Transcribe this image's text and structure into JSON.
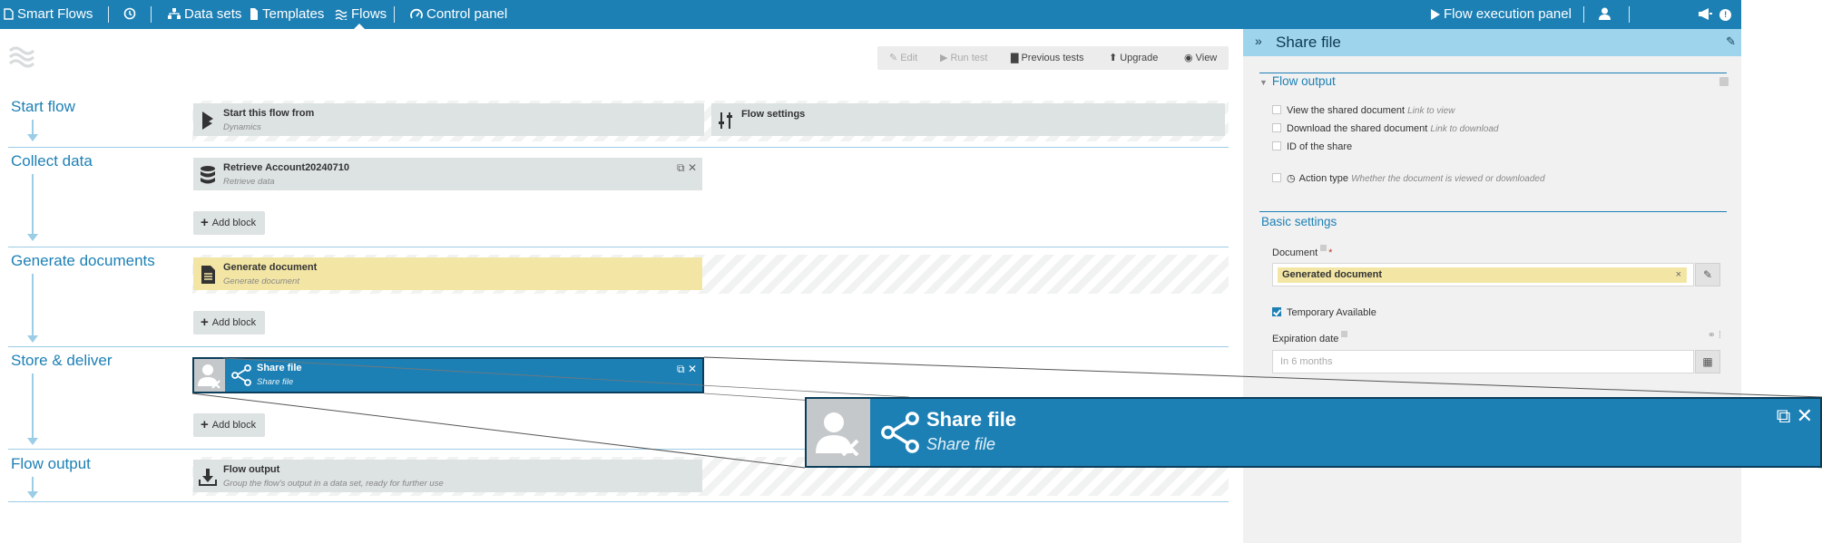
{
  "nav": {
    "app_name": "Smart Flows",
    "datasets": "Data sets",
    "templates": "Templates",
    "flows": "Flows",
    "control_panel": "Control panel",
    "execution_panel": "Flow execution panel",
    "notification_count": "!"
  },
  "toolbar": {
    "edit": "Edit",
    "run_test": "Run test",
    "previous_tests": "Previous tests",
    "upgrade": "Upgrade",
    "view": "View"
  },
  "stages": [
    {
      "title": "Start flow"
    },
    {
      "title": "Collect data"
    },
    {
      "title": "Generate documents"
    },
    {
      "title": "Store & deliver"
    },
    {
      "title": "Flow output"
    }
  ],
  "blocks": {
    "start_from": {
      "title": "Start this flow from",
      "sub": "Dynamics"
    },
    "flow_settings": {
      "title": "Flow settings"
    },
    "retrieve": {
      "title": "Retrieve Account20240710",
      "sub": "Retrieve data"
    },
    "generate": {
      "title": "Generate document",
      "sub": "Generate document"
    },
    "share": {
      "title": "Share file",
      "sub": "Share file"
    },
    "output": {
      "title": "Flow output",
      "sub": "Group the flow's output in a data set, ready for further use"
    }
  },
  "add_block_label": "Add block",
  "panel": {
    "title": "Share file",
    "flow_output_title": "Flow output",
    "outputs": [
      {
        "label": "View the shared document",
        "hint": "Link to view"
      },
      {
        "label": "Download the shared document",
        "hint": "Link to download"
      },
      {
        "label": "ID of the share",
        "hint": ""
      }
    ],
    "action_type": {
      "label": "Action type",
      "hint": "Whether the document is viewed or downloaded"
    },
    "basic_settings_title": "Basic settings",
    "document_label": "Document",
    "required_mark": "*",
    "document_value": "Generated document",
    "temporary_label": "Temporary Available",
    "temporary_checked": true,
    "expiration_label": "Expiration date",
    "expiration_placeholder": "In 6 months"
  },
  "zoom": {
    "title": "Share file",
    "sub": "Share file"
  },
  "colors": {
    "brand": "#1d80b5",
    "panel_header": "#9ed4ec",
    "block_grey": "#dde2e3",
    "block_yellow": "#f3e6a5",
    "selected_border": "#0b3e5a"
  }
}
